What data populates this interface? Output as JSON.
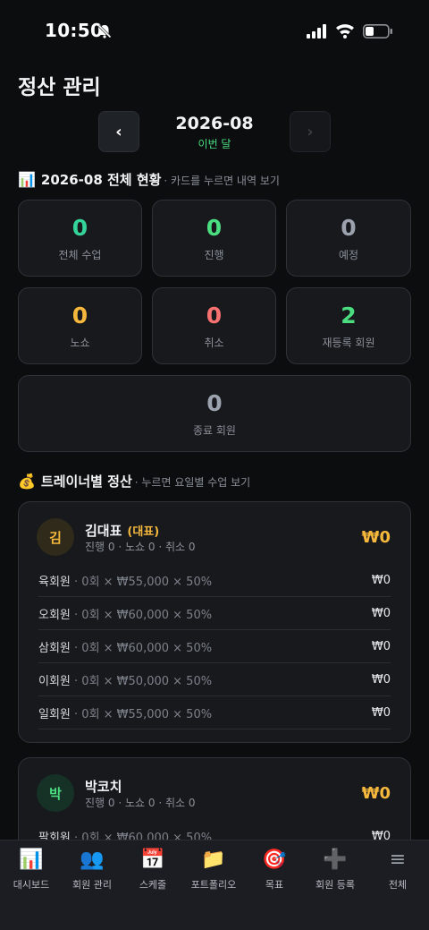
{
  "status_bar": {
    "time": "10:50"
  },
  "page": {
    "title": "정산 관리"
  },
  "month_nav": {
    "prev_label": "‹",
    "next_label": "›",
    "month": "2026-08",
    "sublabel": "이번 달"
  },
  "overview": {
    "icon": "📊",
    "title": "2026-08 전체 현황",
    "hint": "· 카드를 누르면 내역 보기",
    "stats": [
      {
        "value": "0",
        "label": "전체 수업",
        "color": "#34d399"
      },
      {
        "value": "0",
        "label": "진행",
        "color": "#4ade80"
      },
      {
        "value": "0",
        "label": "예정",
        "color": "#9ca3af"
      },
      {
        "value": "0",
        "label": "노쇼",
        "color": "#f5b83d"
      },
      {
        "value": "0",
        "label": "취소",
        "color": "#f87171"
      },
      {
        "value": "2",
        "label": "재등록 회원",
        "color": "#4ade80"
      },
      {
        "value": "0",
        "label": "종료 회원",
        "color": "#9ca3af"
      }
    ]
  },
  "trainers_section": {
    "icon": "💰",
    "title": "트레이너별 정산",
    "hint": "· 누르면 요일별 수업 보기"
  },
  "trainers": [
    {
      "initial": "김",
      "name": "김대표",
      "badge": "(대표)",
      "summary": "진행 0 · 노쇼 0 · 취소 0",
      "total": "₩0",
      "members": [
        {
          "name": "육회원",
          "detail": "· 0회 × ₩55,000 × 50%",
          "amount": "₩0"
        },
        {
          "name": "오회원",
          "detail": "· 0회 × ₩60,000 × 50%",
          "amount": "₩0"
        },
        {
          "name": "삼회원",
          "detail": "· 0회 × ₩60,000 × 50%",
          "amount": "₩0"
        },
        {
          "name": "이회원",
          "detail": "· 0회 × ₩50,000 × 50%",
          "amount": "₩0"
        },
        {
          "name": "일회원",
          "detail": "· 0회 × ₩55,000 × 50%",
          "amount": "₩0"
        }
      ]
    },
    {
      "initial": "박",
      "name": "박코치",
      "badge": "",
      "summary": "진행 0 · 노쇼 0 · 취소 0",
      "total": "₩0",
      "members": [
        {
          "name": "팔회원",
          "detail": "· 0회 × ₩60,000 × 50%",
          "amount": "₩0"
        }
      ]
    }
  ],
  "tabbar": [
    {
      "icon": "📊",
      "label": "대시보드"
    },
    {
      "icon": "👥",
      "label": "회원 관리"
    },
    {
      "icon": "📅",
      "label": "스케줄"
    },
    {
      "icon": "📁",
      "label": "포트폴리오"
    },
    {
      "icon": "🎯",
      "label": "목표"
    },
    {
      "icon": "➕",
      "label": "회원 등록"
    },
    {
      "icon": "≡",
      "label": "전체"
    }
  ]
}
